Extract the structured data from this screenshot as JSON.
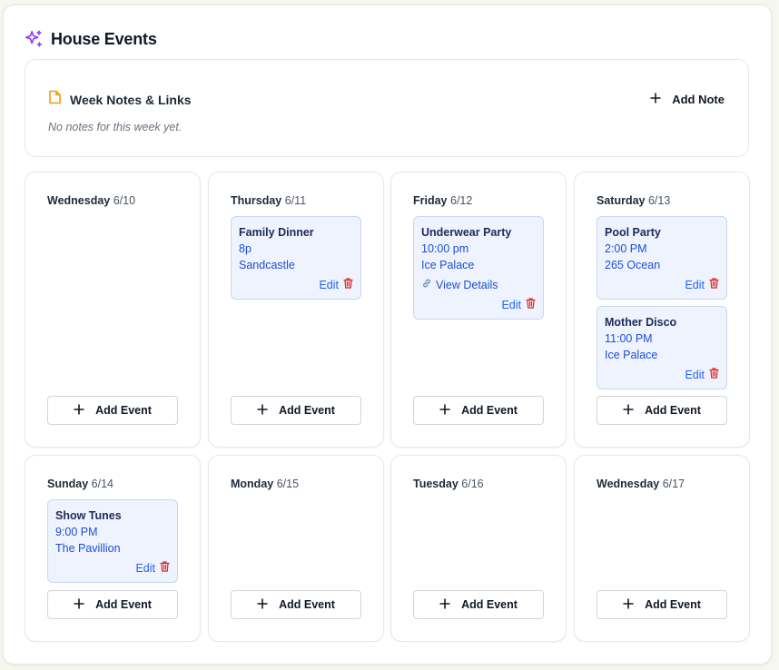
{
  "app": {
    "title": "House Events",
    "accent": "#8b3ff5"
  },
  "notes": {
    "title": "Week Notes & Links",
    "empty_text": "No notes for this week yet.",
    "add_label": "Add Note"
  },
  "add_event_label": "Add Event",
  "days": [
    {
      "name": "Wednesday",
      "date": "6/10",
      "events": []
    },
    {
      "name": "Thursday",
      "date": "6/11",
      "events": [
        {
          "title": "Family Dinner",
          "time": "8p",
          "location": "Sandcastle",
          "edit": "Edit"
        }
      ]
    },
    {
      "name": "Friday",
      "date": "6/12",
      "events": [
        {
          "title": "Underwear Party",
          "time": "10:00 pm",
          "location": "Ice Palace",
          "link": "View Details",
          "edit": "Edit"
        }
      ]
    },
    {
      "name": "Saturday",
      "date": "6/13",
      "events": [
        {
          "title": "Pool Party",
          "time": "2:00 PM",
          "location": "265 Ocean",
          "edit": "Edit"
        },
        {
          "title": "Mother Disco",
          "time": "11:00 PM",
          "location": "Ice Palace",
          "edit": "Edit"
        }
      ]
    },
    {
      "name": "Sunday",
      "date": "6/14",
      "events": [
        {
          "title": "Show Tunes",
          "time": "9:00 PM",
          "location": "The Pavillion",
          "edit": "Edit"
        }
      ]
    },
    {
      "name": "Monday",
      "date": "6/15",
      "events": []
    },
    {
      "name": "Tuesday",
      "date": "6/16",
      "events": []
    },
    {
      "name": "Wednesday",
      "date": "6/17",
      "events": []
    }
  ]
}
